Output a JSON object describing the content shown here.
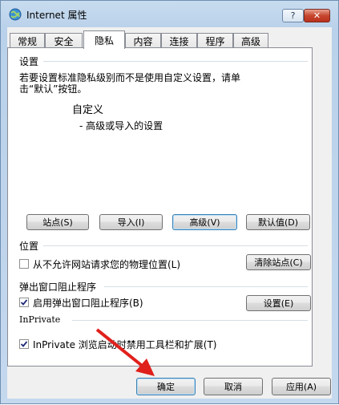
{
  "window": {
    "title": "Internet 属性",
    "help_label": "?",
    "close_label": "✕"
  },
  "tabs": [
    {
      "label": "常规"
    },
    {
      "label": "安全"
    },
    {
      "label": "隐私"
    },
    {
      "label": "内容"
    },
    {
      "label": "连接"
    },
    {
      "label": "程序"
    },
    {
      "label": "高级"
    }
  ],
  "active_tab": "隐私",
  "settings": {
    "title": "设置",
    "desc_line1": "若要设置标准隐私级别而不是使用自定义设置，请单",
    "desc_line2": "击“默认”按钮。",
    "level": "自定义",
    "level_note": "- 高级或导入的设置",
    "buttons": {
      "sites": "站点(S)",
      "import": "导入(I)",
      "advanced": "高级(V)",
      "default": "默认值(D)"
    }
  },
  "location": {
    "title": "位置",
    "checkbox_label": "从不允许网站请求您的物理位置(L)",
    "checked": false,
    "clear_button": "清除站点(C)"
  },
  "popup": {
    "title": "弹出窗口阻止程序",
    "checkbox_label": "启用弹出窗口阻止程序(B)",
    "checked": true,
    "settings_button": "设置(E)"
  },
  "inprivate": {
    "title": "InPrivate",
    "checkbox_label": "InPrivate 浏览启动时禁用工具栏和扩展(T)",
    "checked": true
  },
  "footer": {
    "ok": "确定",
    "cancel": "取消",
    "apply": "应用(A)"
  },
  "colors": {
    "annotation_arrow": "#e0201c",
    "window_frame": "#b9d1ea"
  }
}
